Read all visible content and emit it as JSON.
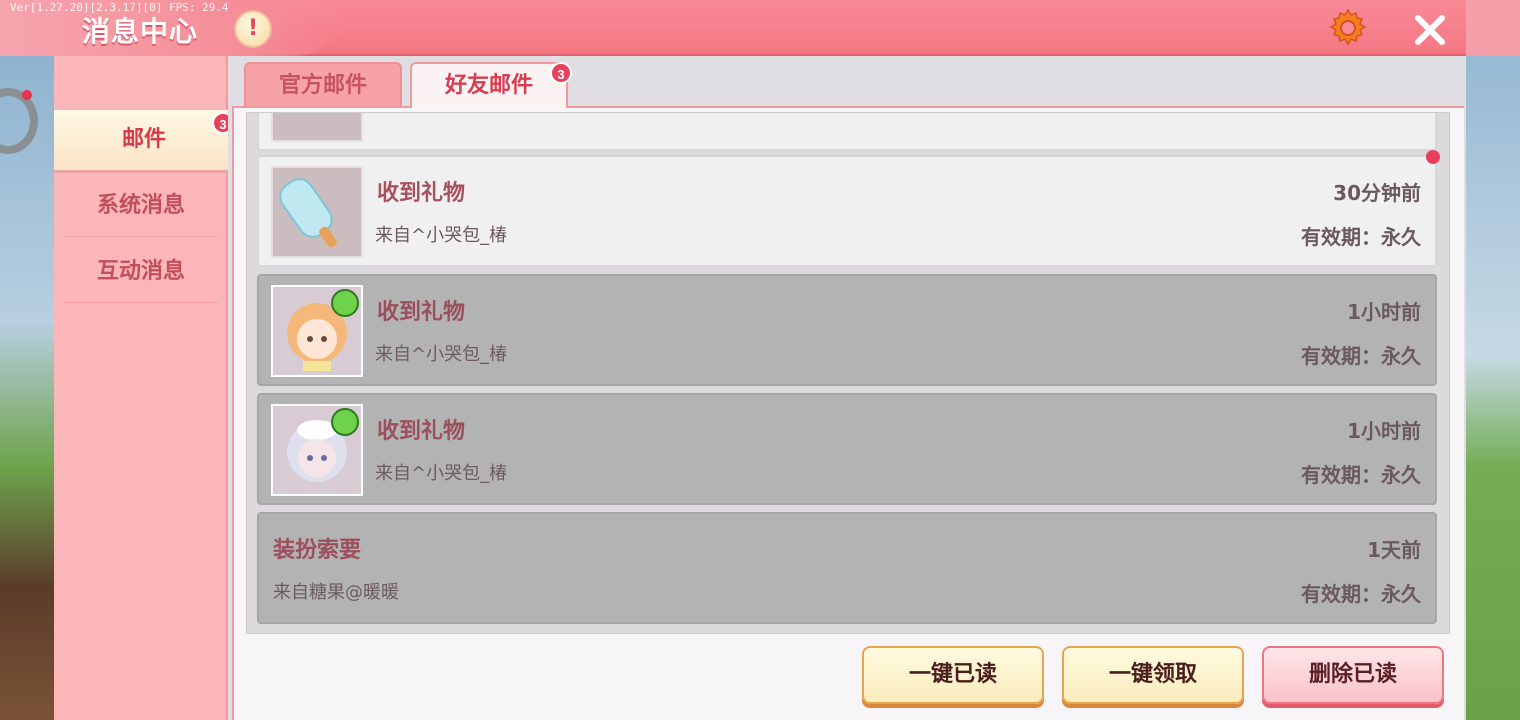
{
  "header": {
    "version": "Ver[1.27.20][2.3.17][0] FPS: 29.4",
    "title": "消息中心",
    "alert_glyph": "!"
  },
  "sidebar": {
    "items": [
      {
        "label": "邮件",
        "badge": "3",
        "selected": true
      },
      {
        "label": "系统消息"
      },
      {
        "label": "互动消息"
      }
    ]
  },
  "tabs": [
    {
      "label": "官方邮件"
    },
    {
      "label": "好友邮件",
      "badge": "3",
      "selected": true
    }
  ],
  "mails": [
    {
      "title": "收到礼物",
      "from": "来自^小哭包_椿",
      "time": "30分钟前",
      "expire": "有效期：永久",
      "read": false,
      "icon": "popsicle-icon"
    },
    {
      "title": "收到礼物",
      "from": "来自^小哭包_椿",
      "time": "1小时前",
      "expire": "有效期：永久",
      "read": true,
      "icon": "avatar-orange-girl"
    },
    {
      "title": "收到礼物",
      "from": "来自^小哭包_椿",
      "time": "1小时前",
      "expire": "有效期：永久",
      "read": true,
      "icon": "avatar-white-girl"
    },
    {
      "title": "装扮索要",
      "from": "来自糖果@暖暖",
      "time": "1天前",
      "expire": "有效期：永久",
      "read": true
    }
  ],
  "buttons": {
    "mark_read": "一键已读",
    "claim_all": "一键领取",
    "delete_read": "删除已读"
  },
  "colors": {
    "header": "#f57683",
    "accent_red": "#e8405a",
    "sidebar": "#fbb6ba"
  }
}
